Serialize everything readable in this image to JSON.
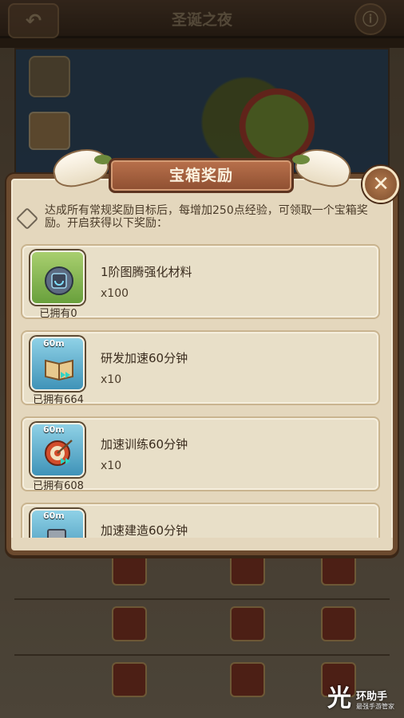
{
  "background": {
    "title": "圣诞之夜",
    "back_glyph": "↶",
    "menu_glyph": "ⓘ"
  },
  "modal": {
    "title": "宝箱奖励",
    "close_glyph": "✕",
    "description": "达成所有常规奖励目标后，每增加250点经验，可领取一个宝箱奖励。开启获得以下奖励：",
    "rewards": [
      {
        "name": "1阶图腾强化材料",
        "qty": "x100",
        "owned": "已拥有0",
        "badge": "",
        "icon": "totem-material-icon",
        "color": "green"
      },
      {
        "name": "研发加速60分钟",
        "qty": "x10",
        "owned": "已拥有664",
        "badge": "60m",
        "icon": "research-speedup-icon",
        "color": "blue"
      },
      {
        "name": "加速训练60分钟",
        "qty": "x10",
        "owned": "已拥有608",
        "badge": "60m",
        "icon": "training-speedup-icon",
        "color": "blue"
      },
      {
        "name": "加速建造60分钟",
        "qty": "",
        "owned": "",
        "badge": "60m",
        "icon": "building-speedup-icon",
        "color": "blue"
      }
    ]
  },
  "watermark": {
    "mark": "光",
    "text": "环助手",
    "sub": "最强手游管家"
  },
  "colors": {
    "banner": "#9a5a3a",
    "panel": "#e4d7bd",
    "border": "#6b4a2e"
  }
}
